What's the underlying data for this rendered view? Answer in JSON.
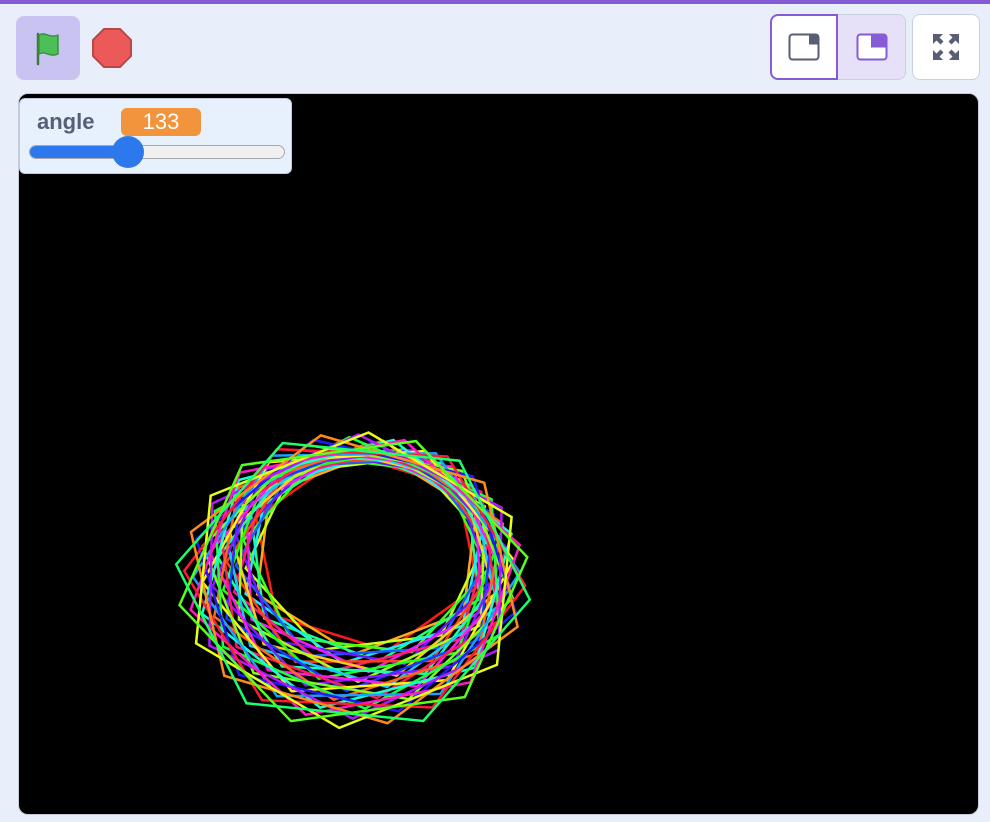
{
  "toolbar": {
    "green_flag_icon": "green-flag-icon",
    "stop_icon": "stop-sign-icon",
    "small_stage_icon": "small-stage-layout-icon",
    "large_stage_icon": "large-stage-layout-icon",
    "fullscreen_icon": "fullscreen-icon",
    "accent_color": "#855cd6"
  },
  "monitor": {
    "label": "angle",
    "value": "133",
    "slider_min": 0,
    "slider_max": 360,
    "slider_value": 133,
    "value_color": "#f1943b",
    "slider_color": "#2e78ee"
  },
  "stage": {
    "background": "#000000",
    "pattern_angle": 133
  }
}
